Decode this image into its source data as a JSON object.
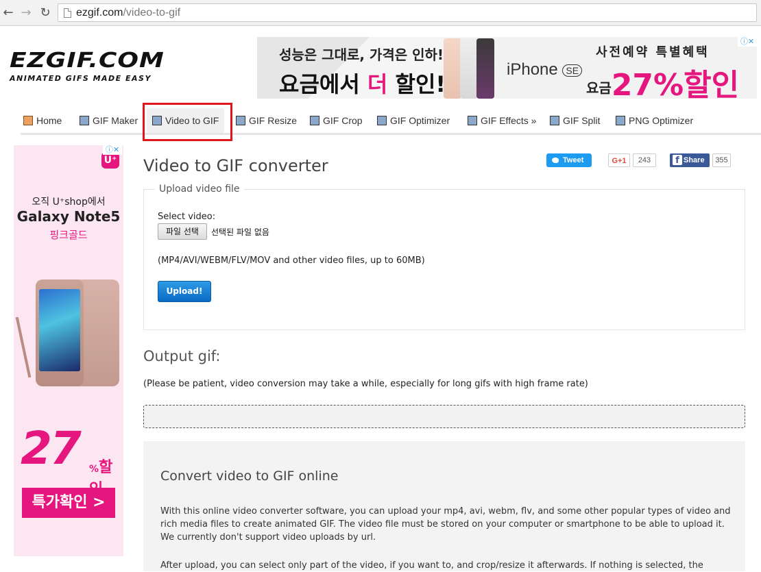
{
  "browser": {
    "url_host": "ezgif.com",
    "url_path": "/video-to-gif"
  },
  "logo": {
    "title": "EZGIF.COM",
    "tagline": "ANIMATED GIFS MADE EASY"
  },
  "top_ad": {
    "line1": "성능은 그대로, 가격은 인하!",
    "line2_pre": "요금에서 ",
    "line2_highlight": "더",
    "line2_post": " 할인!",
    "product": "iPhone",
    "product_badge": "SE",
    "promo_title": "사전예약 특별혜택",
    "promo_prefix": "요금",
    "promo_value": "27%할인",
    "adchoice": "ⓘ✕"
  },
  "nav": {
    "items": [
      {
        "label": "Home",
        "icon": "house-icon"
      },
      {
        "label": "GIF Maker",
        "icon": "film-icon"
      },
      {
        "label": "Video to GIF",
        "icon": "film-icon"
      },
      {
        "label": "GIF Resize",
        "icon": "resize-icon"
      },
      {
        "label": "GIF Crop",
        "icon": "crop-icon"
      },
      {
        "label": "GIF Optimizer",
        "icon": "optimize-icon"
      },
      {
        "label": "GIF Effects »",
        "icon": "effects-icon"
      },
      {
        "label": "GIF Split",
        "icon": "split-icon"
      },
      {
        "label": "PNG Optimizer",
        "icon": "png-icon"
      }
    ],
    "active_index": 2
  },
  "left_ad": {
    "line1": "오직 U⁺shop에서",
    "line2": "Galaxy Note5",
    "line3": "핑크골드",
    "big": "27",
    "sale": "할인",
    "sale_prefix": "%",
    "button": "특가확인 >",
    "brand": "U⁺",
    "adchoice": "ⓘ✕"
  },
  "main": {
    "title": "Video to GIF converter",
    "share": {
      "tweet": "Tweet",
      "gplus": "G+1",
      "gplus_count": "243",
      "fb": "Share",
      "fb_count": "355"
    },
    "upload_legend": "Upload video file",
    "select_label": "Select video:",
    "file_button": "파일 선택",
    "no_file": "선택된 파일 없음",
    "formats_hint": "(MP4/AVI/WEBM/FLV/MOV and other video files, up to 60MB)",
    "upload_button": "Upload!",
    "output_title": "Output gif:",
    "patience_note": "(Please be patient, video conversion may take a while, especially for long gifs with high frame rate)",
    "info_title": "Convert video to GIF online",
    "info_p1": "With this online video converter software, you can upload your mp4, avi, webm, flv, and some other popular types of video and rich media files to create animated GIF. The video file must be stored on your computer or smartphone to be able to upload it. We currently don't support video uploads by url.",
    "info_p2": "After upload, you can select only part of the video, if you want to, and crop/resize it afterwards. If nothing is selected, the"
  }
}
